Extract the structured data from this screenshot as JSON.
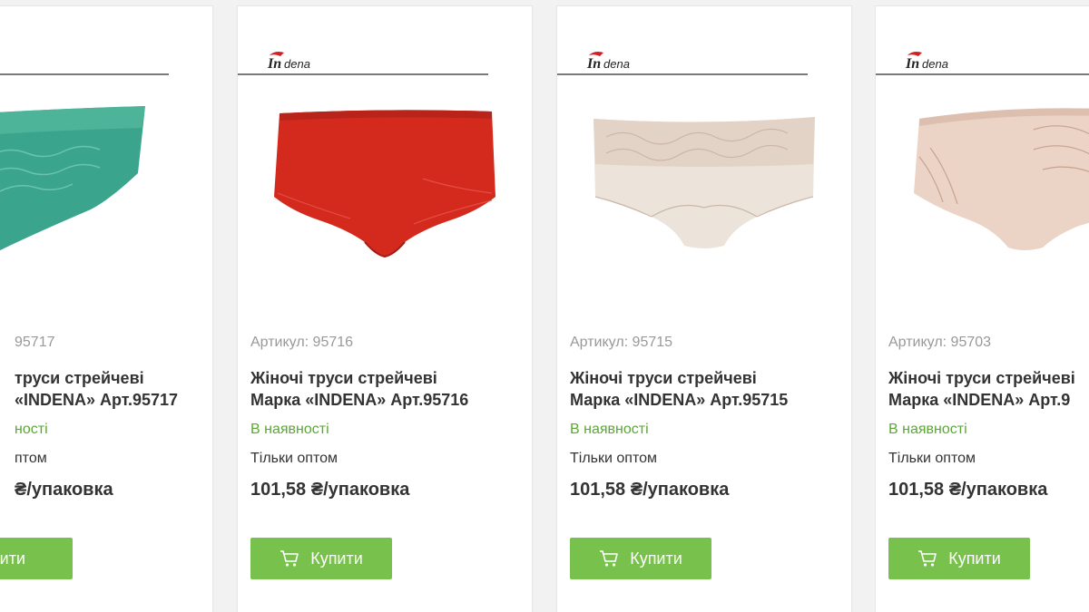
{
  "brand": {
    "name": "Indena",
    "logo_color": "#d11f26"
  },
  "colors": {
    "in_stock": "#5aa832",
    "button_bg": "#79c14d",
    "sku_text": "#999999",
    "body_text": "#333333"
  },
  "products": [
    {
      "sku_label": "95717",
      "title_line1": "труси стрейчеві",
      "title_line2": "«INDENA» Арт.95717",
      "stock": "ності",
      "wholesale": "птом",
      "price": "₴/упаковка",
      "buy_label": "упити",
      "garment_color": "#3aa58c"
    },
    {
      "sku_label": "Артикул: 95716",
      "title_line1": "Жіночі труси стрейчеві",
      "title_line2": "Марка «INDENA» Арт.95716",
      "stock": "В наявності",
      "wholesale": "Тільки оптом",
      "price": "101,58 ₴/упаковка",
      "buy_label": "Купити",
      "garment_color": "#d42a1e"
    },
    {
      "sku_label": "Артикул: 95715",
      "title_line1": "Жіночі труси стрейчеві",
      "title_line2": "Марка «INDENA» Арт.95715",
      "stock": "В наявності",
      "wholesale": "Тільки оптом",
      "price": "101,58 ₴/упаковка",
      "buy_label": "Купити",
      "garment_color": "#ece3da"
    },
    {
      "sku_label": "Артикул: 95703",
      "title_line1": "Жіночі труси стрейчеві",
      "title_line2": "Марка «INDENA» Арт.9",
      "stock": "В наявності",
      "wholesale": "Тільки оптом",
      "price": "101,58 ₴/упаковка",
      "buy_label": "Купити",
      "garment_color": "#ebd3c5"
    }
  ]
}
